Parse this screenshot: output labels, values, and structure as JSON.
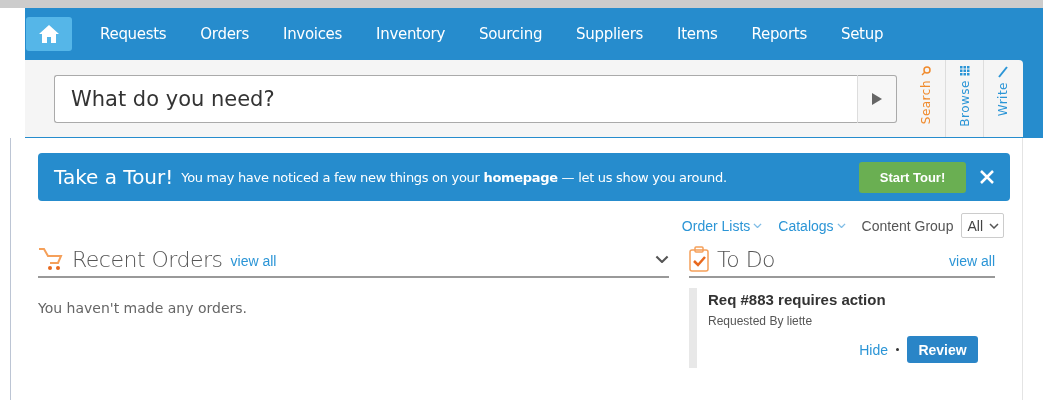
{
  "nav": {
    "home": {
      "selected": true
    },
    "items": [
      {
        "label": "Requests",
        "selected": false
      },
      {
        "label": "Orders",
        "selected": false
      },
      {
        "label": "Invoices",
        "selected": false
      },
      {
        "label": "Inventory",
        "selected": false
      },
      {
        "label": "Sourcing",
        "selected": false
      },
      {
        "label": "Suppliers",
        "selected": false
      },
      {
        "label": "Items",
        "selected": false
      },
      {
        "label": "Reports",
        "selected": false
      },
      {
        "label": "Setup",
        "selected": false
      }
    ]
  },
  "search": {
    "placeholder": "What do you need?",
    "modes": [
      {
        "label": "Search",
        "kind": "search",
        "selected": true
      },
      {
        "label": "Browse",
        "kind": "browse",
        "selected": false
      },
      {
        "label": "Write",
        "kind": "write",
        "selected": false
      }
    ]
  },
  "tour": {
    "title": "Take a Tour!",
    "message": "You may have noticed a few new things on your **homepage** — let us show you around.",
    "button": "Start Tour!"
  },
  "filters": {
    "links": [
      "Order Lists",
      "Catalogs"
    ],
    "content_group": {
      "label": "Content Group",
      "value": "All"
    }
  },
  "recent_orders": {
    "title": "Recent Orders",
    "link": "view all",
    "empty": "You haven't made any orders."
  },
  "todo": {
    "title": "To Do",
    "link": "view all",
    "items": [
      {
        "title": "Req #883 requires action",
        "subtitle": "Requested By liette",
        "hide": "Hide",
        "action": "Review"
      }
    ]
  }
}
